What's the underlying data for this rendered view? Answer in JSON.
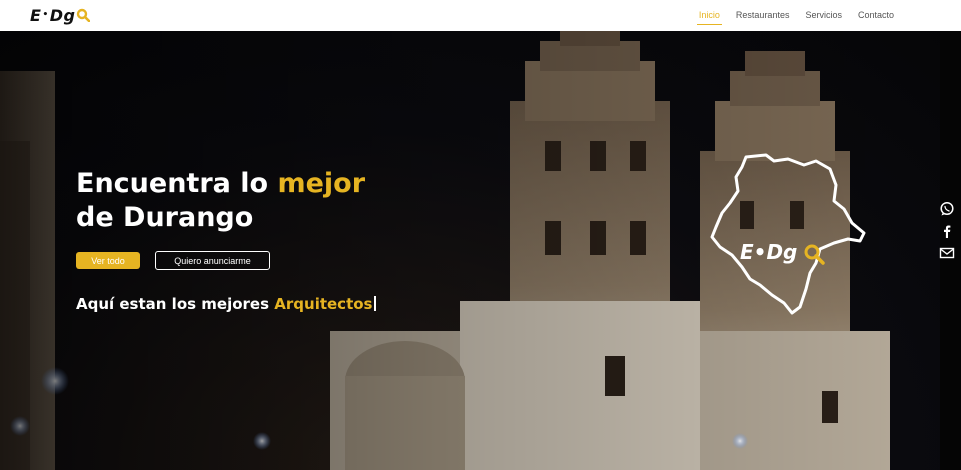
{
  "brand": {
    "logo_left": "E",
    "logo_sep": "•",
    "logo_right": "Dg",
    "accent_color": "#e6b422"
  },
  "nav": {
    "items": [
      {
        "label": "Inicio",
        "active": true
      },
      {
        "label": "Restaurantes",
        "active": false
      },
      {
        "label": "Servicios",
        "active": false
      },
      {
        "label": "Contacto",
        "active": false
      }
    ]
  },
  "hero": {
    "title_part1": "Encuentra lo ",
    "title_accent": "mejor",
    "title_part2": "de Durango",
    "primary_button": "Ver todo",
    "secondary_button": "Quiero anunciarme",
    "typing_prefix": "Aquí estan los mejores ",
    "typing_accent": "Arquitectos",
    "map_logo_left": "E",
    "map_logo_sep": "•",
    "map_logo_right": "Dg"
  },
  "social": {
    "icons": [
      "whatsapp-icon",
      "facebook-icon",
      "email-icon"
    ]
  }
}
